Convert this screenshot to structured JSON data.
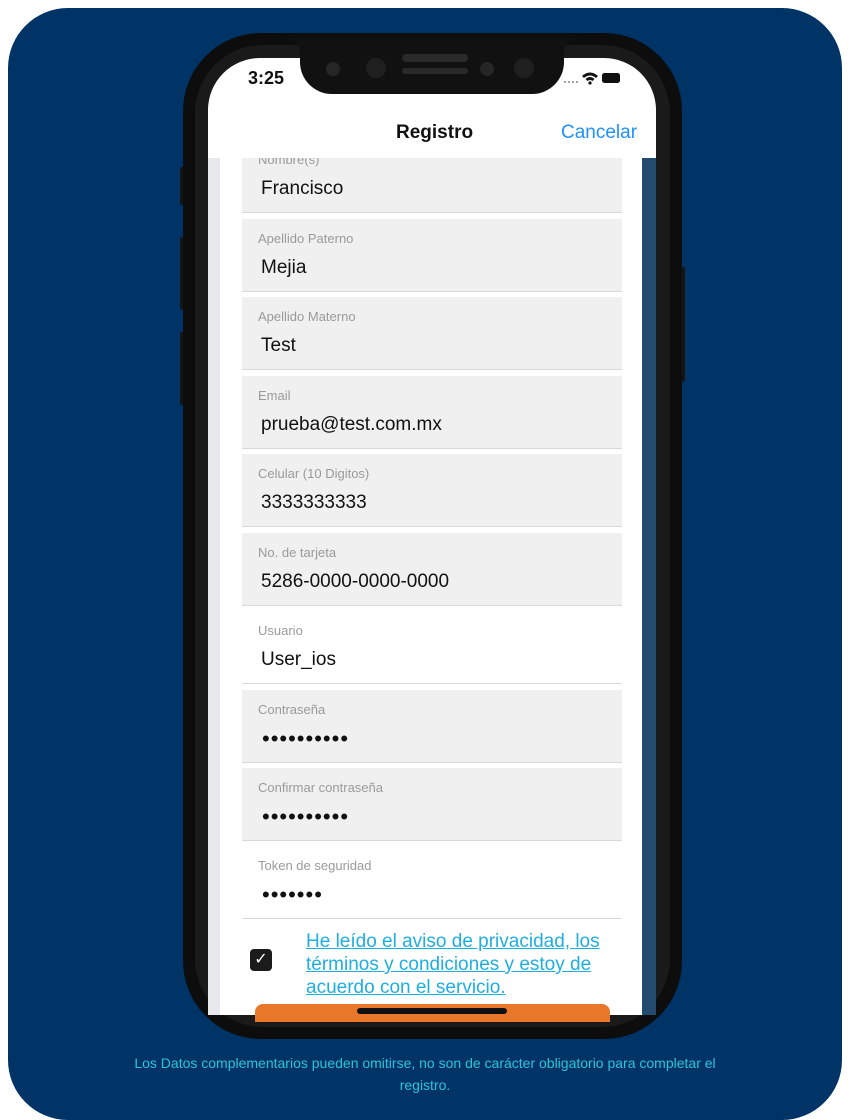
{
  "status_bar": {
    "time": "3:25",
    "indicators": "····  ⌔ ▬"
  },
  "nav_bar": {
    "title": "Registro",
    "cancel_label": "Cancelar"
  },
  "form": {
    "fields": [
      {
        "label": "Nombre(s)",
        "value": "Francisco"
      },
      {
        "label": "Apellido Paterno",
        "value": "Mejia"
      },
      {
        "label": "Apellido Materno",
        "value": "Test"
      },
      {
        "label": "Email",
        "value": "prueba@test.com.mx"
      },
      {
        "label": "Celular (10 Digitos)",
        "value": "3333333333"
      },
      {
        "label": "No. de tarjeta",
        "value": "5286-0000-0000-0000"
      },
      {
        "label": "Usuario",
        "value": "User_ios"
      },
      {
        "label": "Contraseña",
        "value": "••••••••••"
      },
      {
        "label": "Confirmar contraseña",
        "value": "••••••••••"
      },
      {
        "label": "Token de seguridad",
        "value": "•••••••"
      }
    ]
  },
  "terms": {
    "checked": true,
    "check_mark": "✓",
    "text": "He leído el aviso de privacidad, los términos y condiciones y estoy de acuerdo con el servicio."
  },
  "footer_note": "Los Datos complementarios pueden omitirse, no son de carácter obligatorio para completar el registro.",
  "colors": {
    "background": "#003366",
    "link": "#1faee0",
    "accent_blue": "#1e90ff",
    "button_orange": "#e8772a",
    "note": "#2bc4d8"
  }
}
